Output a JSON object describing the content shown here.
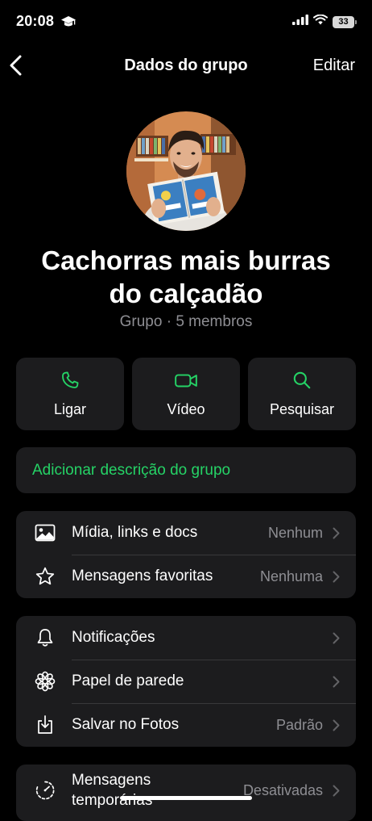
{
  "status_bar": {
    "time": "20:08",
    "battery": "33"
  },
  "nav": {
    "title": "Dados do grupo",
    "edit": "Editar"
  },
  "group": {
    "name_line1": "Cachorras mais burras",
    "name_line2": "do calçadão",
    "subtitle": "Grupo · 5 membros"
  },
  "actions": [
    {
      "label": "Ligar",
      "icon": "phone-icon"
    },
    {
      "label": "Vídeo",
      "icon": "video-icon"
    },
    {
      "label": "Pesquisar",
      "icon": "search-icon"
    }
  ],
  "description": {
    "label": "Adicionar descrição do grupo"
  },
  "section1": [
    {
      "label": "Mídia, links e docs",
      "value": "Nenhum",
      "icon": "photo-icon"
    },
    {
      "label": "Mensagens favoritas",
      "value": "Nenhuma",
      "icon": "star-icon"
    }
  ],
  "section2": [
    {
      "label": "Notificações",
      "value": "",
      "icon": "bell-icon"
    },
    {
      "label": "Papel de parede",
      "value": "",
      "icon": "flower-icon"
    },
    {
      "label": "Salvar no Fotos",
      "value": "Padrão",
      "icon": "download-icon"
    }
  ],
  "section3": [
    {
      "label_line1": "Mensagens",
      "label_line2": "temporárias",
      "value": "Desativadas",
      "icon": "timer-icon"
    }
  ],
  "colors": {
    "accent": "#25d366",
    "card": "#1c1c1e",
    "background": "#000000",
    "secondary": "#8e8e93"
  }
}
